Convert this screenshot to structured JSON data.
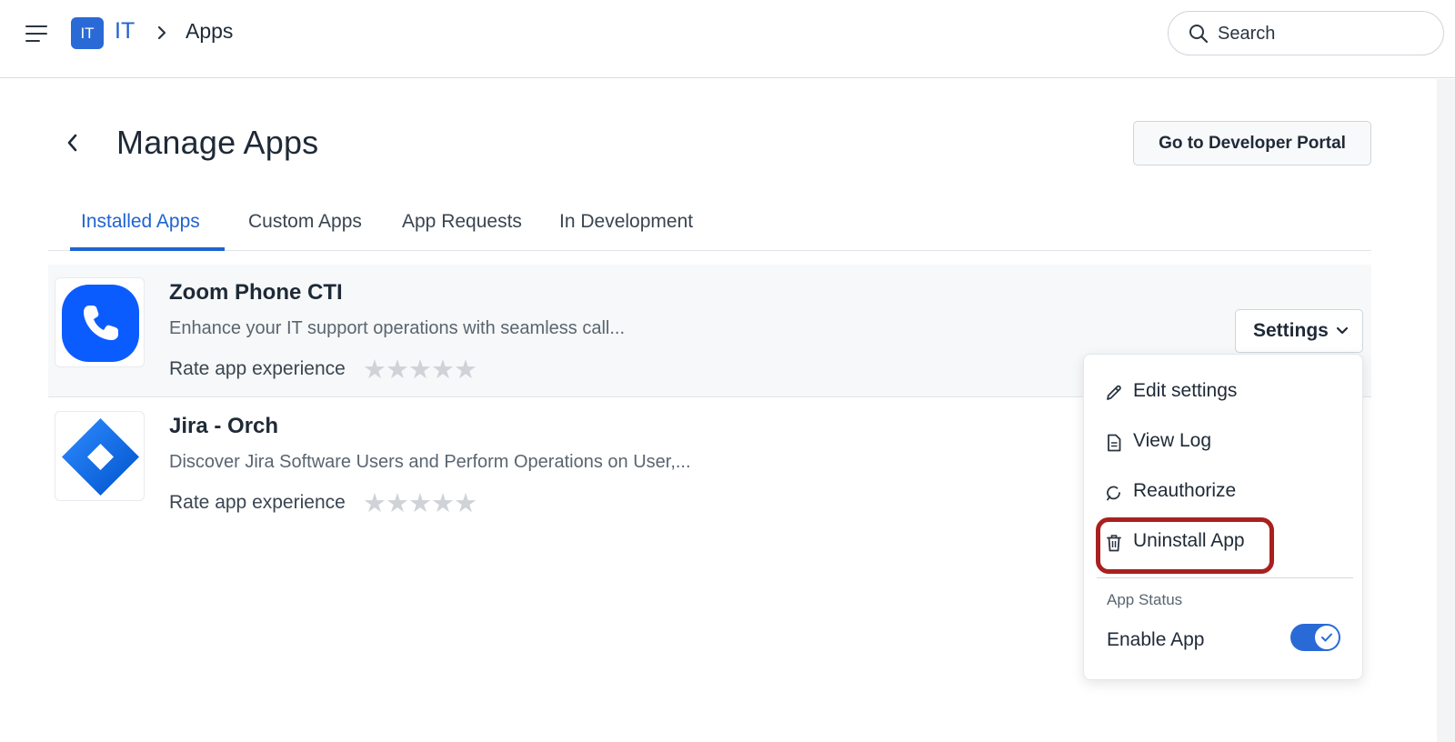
{
  "header": {
    "workspace_badge": "IT",
    "workspace_name": "IT",
    "current_page": "Apps",
    "search_placeholder": "Search"
  },
  "page": {
    "title": "Manage Apps",
    "developer_portal_label": "Go to Developer Portal"
  },
  "tabs": [
    {
      "label": "Installed Apps",
      "active": true
    },
    {
      "label": "Custom Apps",
      "active": false
    },
    {
      "label": "App Requests",
      "active": false
    },
    {
      "label": "In Development",
      "active": false
    }
  ],
  "apps": [
    {
      "name": "Zoom Phone CTI",
      "description": "Enhance your IT support operations with seamless call...",
      "rate_label": "Rate app experience",
      "rating": 0,
      "rating_max": 5,
      "icon": "phone-icon",
      "icon_color": "#0b5cff"
    },
    {
      "name": "Jira - Orch",
      "description": "Discover Jira Software Users and Perform Operations on User,...",
      "rate_label": "Rate app experience",
      "rating": 0,
      "rating_max": 5,
      "icon": "jira-logo",
      "icon_color": "#2684ff"
    }
  ],
  "settings_menu": {
    "button_label": "Settings",
    "items": [
      {
        "label": "Edit settings",
        "icon": "pencil-icon"
      },
      {
        "label": "View Log",
        "icon": "document-icon"
      },
      {
        "label": "Reauthorize",
        "icon": "refresh-icon"
      },
      {
        "label": "Uninstall App",
        "icon": "trash-icon",
        "highlighted": true
      }
    ],
    "status_section_label": "App Status",
    "enable_label": "Enable App",
    "enabled": true
  },
  "colors": {
    "accent": "#1f63d0",
    "highlight_outline": "#a8211e"
  }
}
